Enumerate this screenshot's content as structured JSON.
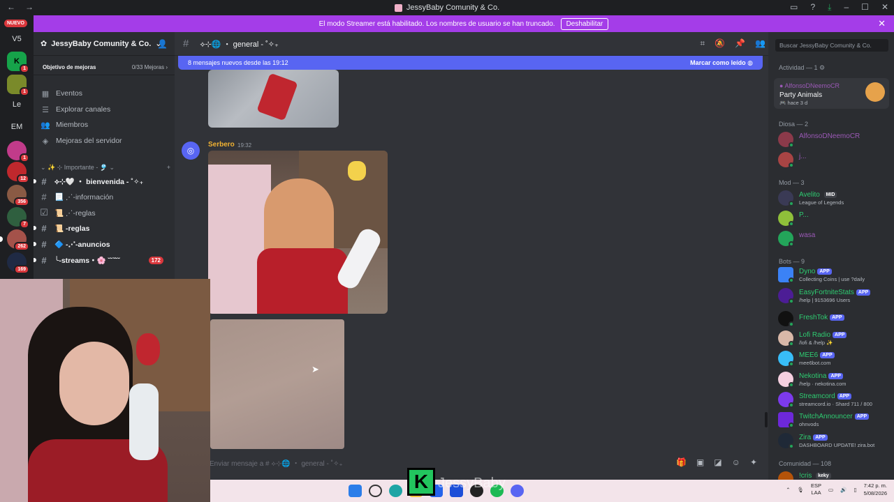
{
  "titlebar": {
    "title": "JessyBaby Comunity & Co."
  },
  "banner": {
    "text": "El modo Streamer está habilitado. Los nombres de usuario se han truncado.",
    "button": "Deshabilitar"
  },
  "rail": {
    "nuevo": "NUEVO",
    "servers": [
      {
        "label": "V5",
        "badge": ""
      },
      {
        "label": "K",
        "badge": "1"
      },
      {
        "label": "",
        "badge": "1"
      },
      {
        "label": "Le",
        "badge": ""
      },
      {
        "label": "EM",
        "badge": ""
      },
      {
        "label": "",
        "badge": "1"
      },
      {
        "label": "",
        "badge": "12"
      },
      {
        "label": "",
        "badge": "356"
      },
      {
        "label": "",
        "badge": "7"
      },
      {
        "label": "",
        "badge": "262"
      },
      {
        "label": "",
        "badge": "169"
      }
    ]
  },
  "sidebar": {
    "server_name": "JessyBaby Comunity & Co.",
    "goal": {
      "label": "Objetivo de mejoras",
      "progress": "0/33 Mejoras"
    },
    "nav": [
      {
        "label": "Eventos",
        "icon": "calendar-icon"
      },
      {
        "label": "Explorar canales",
        "icon": "browse-icon"
      },
      {
        "label": "Miembros",
        "icon": "members-icon"
      },
      {
        "label": "Mejoras del servidor",
        "icon": "boost-icon"
      }
    ],
    "category": "✨ ⊹ Importante - 🎐",
    "channels": [
      {
        "name": "⟡⊹🤍 ・ bienvenida - ˚✧₊",
        "bold": true,
        "count": ""
      },
      {
        "name": "📃 ⋰-información",
        "bold": false,
        "count": ""
      },
      {
        "name": "📜 ⋰-reglas",
        "bold": false,
        "count": ""
      },
      {
        "name": "📜 -reglas",
        "bold": true,
        "count": ""
      },
      {
        "name": "🔷 -⋰-anuncios",
        "bold": true,
        "count": ""
      },
      {
        "name": "╰-streams・🌸 ˘˘ˇ˘˘",
        "bold": true,
        "count": "172"
      }
    ]
  },
  "chat": {
    "channel": "⟡⊹🌐 ・ general - ˚✧₊",
    "new_messages": "8 mensajes nuevos desde las 19:12",
    "mark_read": "Marcar como leído",
    "author": "Serbero",
    "time": "19:32",
    "composer_placeholder": "Enviar mensaje a # ⟡⊹🌐 ・ general - ˚✧₊"
  },
  "members": {
    "search_placeholder": "Buscar JessyBaby Comunity & Co.",
    "activity": {
      "header": "Actividad — 1",
      "user": "AlfonsoDNeemoCR",
      "game": "Party Animals",
      "ago": "hace 3 d"
    },
    "groups": [
      {
        "title": "Diosa — 2",
        "members": [
          {
            "name": "AlfonsoDNeemoCR",
            "sub": "",
            "color": "#9b59b6",
            "tag": ""
          },
          {
            "name": "j...",
            "sub": "",
            "color": "#9b59b6",
            "tag": ""
          }
        ]
      },
      {
        "title": "Mod — 3",
        "members": [
          {
            "name": "Avelito",
            "sub": "League of Legends",
            "color": "#2ecc71",
            "tag": "MID"
          },
          {
            "name": "P...",
            "sub": "",
            "color": "#2ecc71",
            "tag": ""
          },
          {
            "name": "wasa",
            "sub": "",
            "color": "#9b59b6",
            "tag": ""
          }
        ]
      },
      {
        "title": "Bots — 9",
        "members": [
          {
            "name": "Dyno",
            "sub": "Collecting Coins | use ?daily",
            "color": "#2ecc71",
            "tag": "APP"
          },
          {
            "name": "EasyFortniteStats",
            "sub": "/help | 9153696 Users",
            "color": "#2ecc71",
            "tag": "APP"
          },
          {
            "name": "FreshTok",
            "sub": "",
            "color": "#2ecc71",
            "tag": "APP"
          },
          {
            "name": "Lofi Radio",
            "sub": "/lofi & /help ✨",
            "color": "#2ecc71",
            "tag": "APP"
          },
          {
            "name": "MEE6",
            "sub": "mee6bot.com",
            "color": "#2ecc71",
            "tag": "APP"
          },
          {
            "name": "Nekotina",
            "sub": "/help · nekotina.com",
            "color": "#2ecc71",
            "tag": "APP"
          },
          {
            "name": "Streamcord",
            "sub": "streamcord.io · Shard 711 / 800",
            "color": "#2ecc71",
            "tag": "APP"
          },
          {
            "name": "TwitchAnnouncer",
            "sub": "ohnvods",
            "color": "#2ecc71",
            "tag": "APP"
          },
          {
            "name": "Zira",
            "sub": "DASHBOARD UPDATE! zira.bot",
            "color": "#2ecc71",
            "tag": "APP"
          }
        ]
      }
    ],
    "community": "Comunidad — 108",
    "last_visible": {
      "name": "!cris",
      "tag": "keky"
    }
  },
  "overlay": {
    "logo_letter": "K",
    "name": "JessyBaby"
  },
  "taskbar": {
    "lang": "ESP",
    "lang_sub": "LAA",
    "time": "7:42 p. m.",
    "date": "5/08/2026"
  }
}
